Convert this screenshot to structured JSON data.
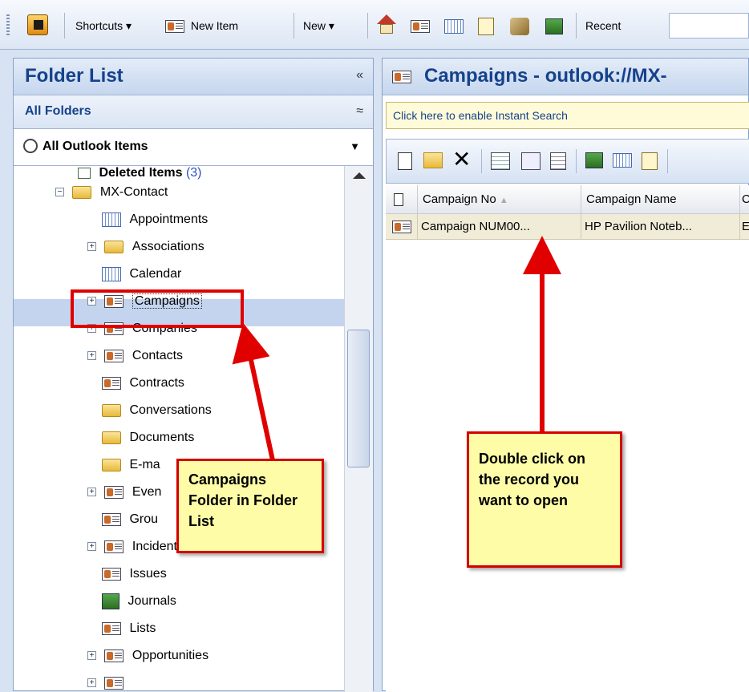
{
  "toolbar": {
    "shortcuts": "Shortcuts ▾",
    "new_item": "New Item",
    "new": "New ▾",
    "recent": "Recent"
  },
  "folder_pane": {
    "title": "Folder List",
    "collapse": "«",
    "all_folders": "All Folders",
    "all_folders_toggle": "≈",
    "selector": "All Outlook Items",
    "selector_arrow": "▼",
    "tree": [
      {
        "label": "Deleted Items",
        "count": "(3)"
      },
      {
        "label": "MX-Contact"
      },
      {
        "label": "Appointments"
      },
      {
        "label": "Associations"
      },
      {
        "label": "Calendar"
      },
      {
        "label": "Campaigns"
      },
      {
        "label": "Companies"
      },
      {
        "label": "Contacts"
      },
      {
        "label": "Contracts"
      },
      {
        "label": "Conversations"
      },
      {
        "label": "Documents"
      },
      {
        "label": "E-ma"
      },
      {
        "label": "Even"
      },
      {
        "label": "Grou"
      },
      {
        "label": "Incidents"
      },
      {
        "label": "Issues"
      },
      {
        "label": "Journals"
      },
      {
        "label": "Lists"
      },
      {
        "label": "Opportunities"
      }
    ]
  },
  "right_pane": {
    "title": "Campaigns - outlook://MX-",
    "search": "Click here to enable Instant Search",
    "columns": [
      "Campaign No",
      "Campaign Name",
      "C"
    ],
    "row": [
      "Campaign NUM00...",
      "HP Pavilion Noteb...",
      "E"
    ]
  },
  "callouts": {
    "left": "Campaigns Folder in Folder List",
    "right": "Double click on the record you want to open"
  }
}
